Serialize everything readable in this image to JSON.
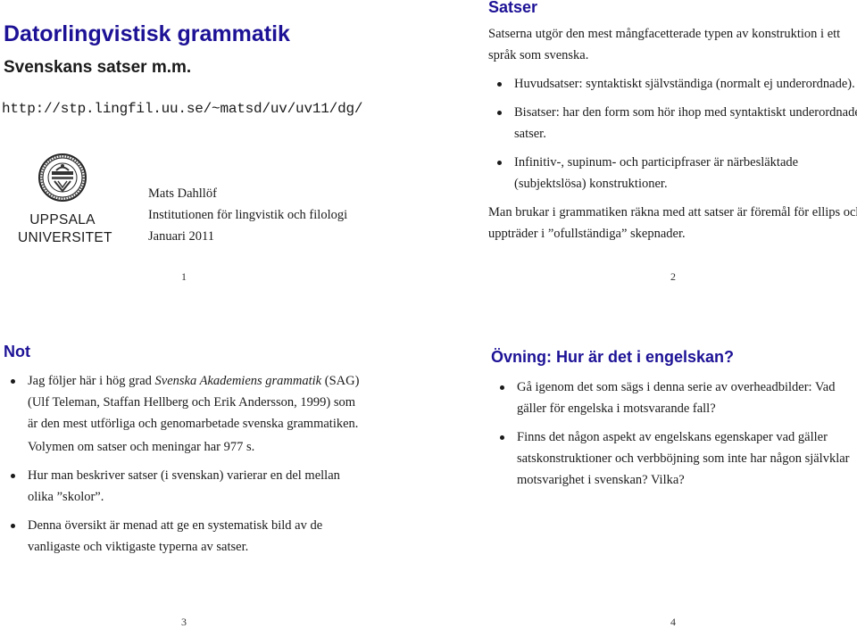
{
  "pages": [
    {
      "number": "1",
      "title": "Datorlingvistisk grammatik",
      "subtitle": "Svenskans satser m.m.",
      "url": "http://stp.lingfil.uu.se/~matsd/uv/uv11/dg/",
      "logo": {
        "icon": "uppsala-university-seal-icon",
        "line1": "UPPSALA",
        "line2": "UNIVERSITET"
      },
      "author": "Mats Dahllöf",
      "department": "Institutionen för lingvistik och filologi",
      "date": "Januari 2011"
    },
    {
      "number": "2",
      "title": "Satser",
      "intro": "Satserna utgör den mest mångfacetterade typen av konstruktion i ett språk som svenska.",
      "bullets": [
        "Huvudsatser: syntaktiskt självständiga (normalt ej underordnade).",
        "Bisatser: har den form som hör ihop med syntaktiskt underordnade satser.",
        "Infinitiv-, supinum- och participfraser är närbesläktade (subjektslösa) konstruktioner."
      ],
      "outro": "Man brukar i grammatiken räkna med att satser är föremål för ellips och uppträder i ”ofullständiga” skepnader."
    },
    {
      "number": "3",
      "title": "Not",
      "bullet1_pre": "Jag följer här i hög grad ",
      "bullet1_italic": "Svenska Akademiens grammatik",
      "bullet1_post": " (SAG) (Ulf Teleman, Staffan Hellberg och Erik Andersson, 1999) som är den mest utförliga och genomarbetade svenska grammatiken.",
      "bullet1_note": "Volymen om satser och meningar har 977 s.",
      "bullet2": "Hur man beskriver satser (i svenskan) varierar en del mellan olika ”skolor”.",
      "bullet3": "Denna översikt är menad att ge en systematisk bild av de vanligaste och viktigaste typerna av satser."
    },
    {
      "number": "4",
      "title": "Övning: Hur är det i engelskan?",
      "bullets": [
        "Gå igenom det som sägs i denna serie av overheadbilder: Vad gäller för engelska i motsvarande fall?",
        "Finns det någon aspekt av engelskans egenskaper vad gäller satskonstruktioner och verbböjning som inte har någon självklar motsvarighet i svenskan? Vilka?"
      ]
    }
  ],
  "colors": {
    "title": "#1d1296",
    "text": "#1a1a1a"
  }
}
